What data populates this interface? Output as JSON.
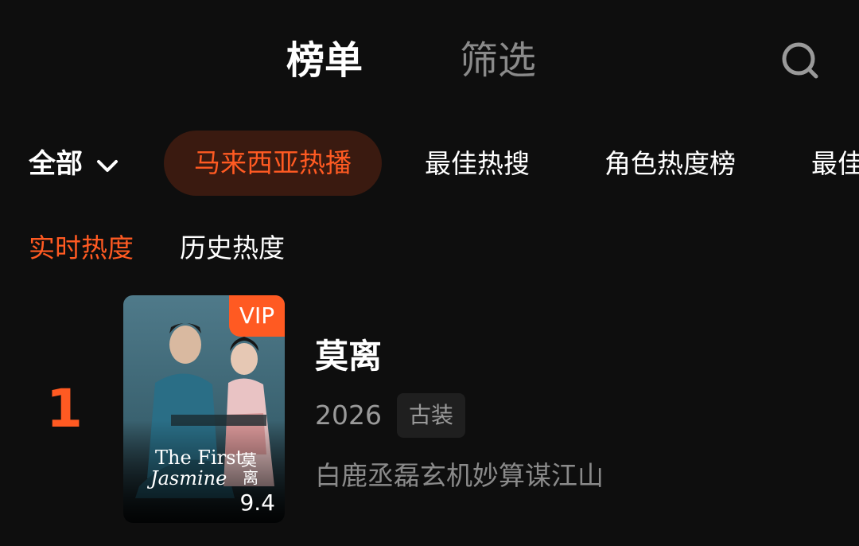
{
  "header": {
    "tabs": [
      {
        "label": "榜单",
        "active": true
      },
      {
        "label": "筛选",
        "active": false
      }
    ],
    "search_icon": "search-icon"
  },
  "category_bar": {
    "all_label": "全部",
    "dropdown_icon": "chevron-down-icon",
    "chips": [
      {
        "label": "马来西亚热播",
        "active": true
      },
      {
        "label": "最佳热搜",
        "active": false
      },
      {
        "label": "角色热度榜",
        "active": false
      },
      {
        "label": "最佳",
        "active": false
      }
    ]
  },
  "sub_tabs": [
    {
      "label": "实时热度",
      "active": true
    },
    {
      "label": "历史热度",
      "active": false
    }
  ],
  "ranking": [
    {
      "rank": "1",
      "poster": {
        "badge": "VIP",
        "poster_text": "The First Jasmine 莫离",
        "score": "9.4"
      },
      "title": "莫离",
      "year": "2026",
      "genre": "古装",
      "description": "白鹿丞磊玄机妙算谋江山"
    }
  ],
  "colors": {
    "accent": "#ff5a22",
    "background": "#0e0e0e",
    "chip_active_bg": "#3a1a10",
    "muted_text": "#8a8a8a"
  }
}
